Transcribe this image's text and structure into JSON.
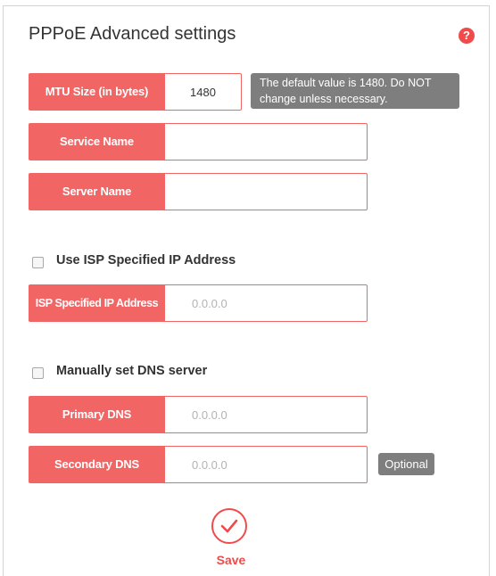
{
  "header": {
    "title": "PPPoE Advanced settings",
    "help_icon": "?"
  },
  "fields": {
    "mtu": {
      "label": "MTU Size (in bytes)",
      "value": "1480"
    },
    "mtu_hint": "The default value is 1480. Do NOT change unless necessary.",
    "service_name": {
      "label": "Service Name",
      "value": ""
    },
    "server_name": {
      "label": "Server Name",
      "value": ""
    }
  },
  "isp_ip": {
    "checkbox_label": "Use ISP Specified IP Address",
    "checked": false,
    "field_label": "ISP Specified IP Address",
    "placeholder": "0.0.0.0"
  },
  "dns": {
    "checkbox_label": "Manually set DNS server",
    "checked": false,
    "primary": {
      "label": "Primary DNS",
      "placeholder": "0.0.0.0"
    },
    "secondary": {
      "label": "Secondary DNS",
      "placeholder": "0.0.0.0"
    },
    "optional_badge": "Optional"
  },
  "actions": {
    "save_label": "Save"
  },
  "colors": {
    "accent": "#f16565",
    "tooltip_bg": "#7e7e7e"
  }
}
